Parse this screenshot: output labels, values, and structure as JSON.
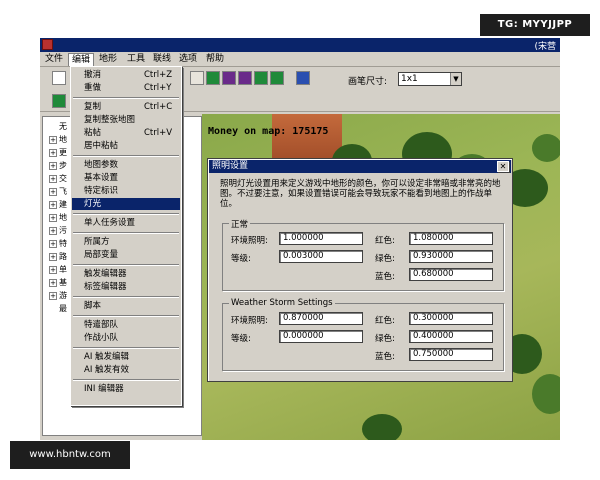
{
  "watermarks": {
    "top": "TG: MYYJJPP",
    "bottom": "www.hbntw.com"
  },
  "window": {
    "title_fragment": "(宋营"
  },
  "menubar": [
    "文件",
    "编辑",
    "地形",
    "工具",
    "联线",
    "选项",
    "帮助"
  ],
  "toolbar": {
    "brush_label": "画笔尺寸:",
    "brush_value": "1x1"
  },
  "tree": {
    "items": [
      {
        "sign": "",
        "label": "无"
      },
      {
        "sign": "+",
        "label": "地"
      },
      {
        "sign": "+",
        "label": "更"
      },
      {
        "sign": "+",
        "label": "步"
      },
      {
        "sign": "+",
        "label": "交"
      },
      {
        "sign": "+",
        "label": "飞"
      },
      {
        "sign": "+",
        "label": "建"
      },
      {
        "sign": "+",
        "label": "地"
      },
      {
        "sign": "+",
        "label": "污"
      },
      {
        "sign": "+",
        "label": "特"
      },
      {
        "sign": "+",
        "label": "路"
      },
      {
        "sign": "+",
        "label": "单"
      },
      {
        "sign": "+",
        "label": "基"
      },
      {
        "sign": "+",
        "label": "游"
      },
      {
        "sign": "",
        "label": "最"
      }
    ]
  },
  "map": {
    "money": "Money on map: 175175"
  },
  "edit_menu": {
    "items": [
      {
        "label": "撤消",
        "shortcut": "Ctrl+Z"
      },
      {
        "label": "重做",
        "shortcut": "Ctrl+Y"
      },
      {
        "label": "复制",
        "shortcut": "Ctrl+C"
      },
      {
        "label": "复制整张地图",
        "shortcut": ""
      },
      {
        "label": "粘帖",
        "shortcut": "Ctrl+V"
      },
      {
        "label": "居中粘帖",
        "shortcut": ""
      },
      {
        "label": "地图参数",
        "shortcut": ""
      },
      {
        "label": "基本设置",
        "shortcut": ""
      },
      {
        "label": "特定标识",
        "shortcut": ""
      },
      {
        "label": "灯光",
        "shortcut": ""
      },
      {
        "label": "单人任务设置",
        "shortcut": ""
      },
      {
        "label": "所属方",
        "shortcut": ""
      },
      {
        "label": "局部变量",
        "shortcut": ""
      },
      {
        "label": "触发编辑器",
        "shortcut": ""
      },
      {
        "label": "标签编辑器",
        "shortcut": ""
      },
      {
        "label": "脚本",
        "shortcut": ""
      },
      {
        "label": "特遣部队",
        "shortcut": ""
      },
      {
        "label": "作战小队",
        "shortcut": ""
      },
      {
        "label": "AI 触发编辑",
        "shortcut": ""
      },
      {
        "label": "AI 触发有效",
        "shortcut": ""
      },
      {
        "label": "INI 编辑器",
        "shortcut": ""
      }
    ],
    "highlighted": "灯光"
  },
  "dialog": {
    "title": "照明设置",
    "close": "✕",
    "description": "照明灯光设置用来定义游戏中地形的颜色，你可以设定非常暗或非常亮的地图。不过要注意，如果设置错误可能会导致玩家不能看到地图上的作战单位。",
    "normal": {
      "title": "正常",
      "ambient_label": "环境照明:",
      "ambient": "1.000000",
      "level_label": "等级:",
      "level": "0.003000",
      "red_label": "红色:",
      "red": "1.080000",
      "green_label": "绿色:",
      "green": "0.930000",
      "blue_label": "蓝色:",
      "blue": "0.680000"
    },
    "storm": {
      "title": "Weather Storm Settings",
      "ambient_label": "环境照明:",
      "ambient": "0.870000",
      "level_label": "等级:",
      "level": "0.000000",
      "red_label": "红色:",
      "red": "0.300000",
      "green_label": "绿色:",
      "green": "0.400000",
      "blue_label": "蓝色:",
      "blue": "0.750000"
    }
  }
}
